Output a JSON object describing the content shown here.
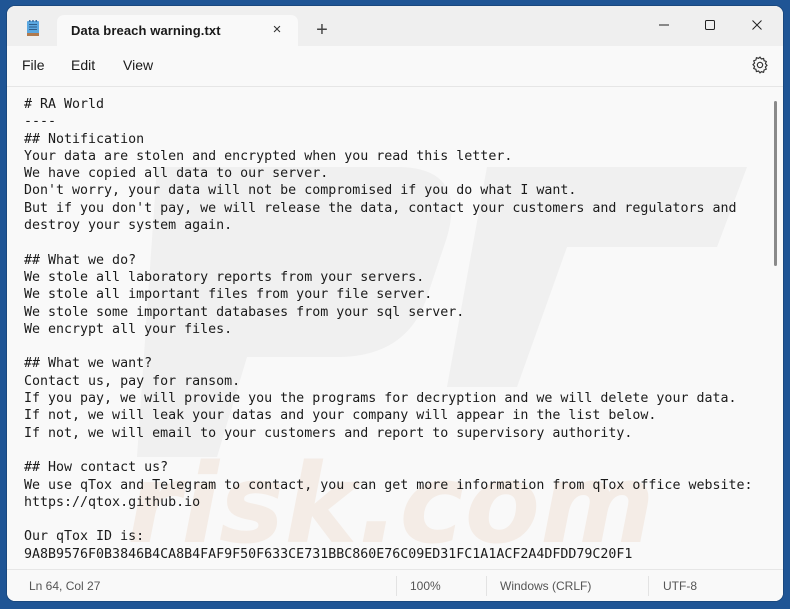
{
  "titlebar": {
    "tab_title": "Data breach warning.txt",
    "tab_close_icon": "×",
    "new_tab_icon": "+"
  },
  "menu": {
    "file": "File",
    "edit": "Edit",
    "view": "View"
  },
  "document": {
    "lines": [
      "# RA World",
      "----",
      "## Notification",
      "Your data are stolen and encrypted when you read this letter.",
      "We have copied all data to our server.",
      "Don't worry, your data will not be compromised if you do what I want.",
      "But if you don't pay, we will release the data, contact your customers and regulators and",
      "destroy your system again.",
      "",
      "## What we do?",
      "We stole all laboratory reports from your servers.",
      "We stole all important files from your file server.",
      "We stole some important databases from your sql server.",
      "We encrypt all your files.",
      "",
      "## What we want?",
      "Contact us, pay for ransom.",
      "If you pay, we will provide you the programs for decryption and we will delete your data.",
      "If not, we will leak your datas and your company will appear in the list below.",
      "If not, we will email to your customers and report to supervisory authority.",
      "",
      "## How contact us?",
      "We use qTox and Telegram to contact, you can get more information from qTox office website:",
      "https://qtox.github.io",
      "",
      "Our qTox ID is:",
      "9A8B9576F0B3846B4CA8B4FAF9F50F633CE731BBC860E76C09ED31FC1A1ACF2A4DFDD79C20F1"
    ]
  },
  "status": {
    "position": "Ln 64, Col 27",
    "zoom": "100%",
    "line_ending": "Windows (CRLF)",
    "encoding": "UTF-8"
  },
  "colors": {
    "desktop": "#1f5595",
    "titlebar": "#efefef",
    "editor": "#f9f9f9"
  }
}
